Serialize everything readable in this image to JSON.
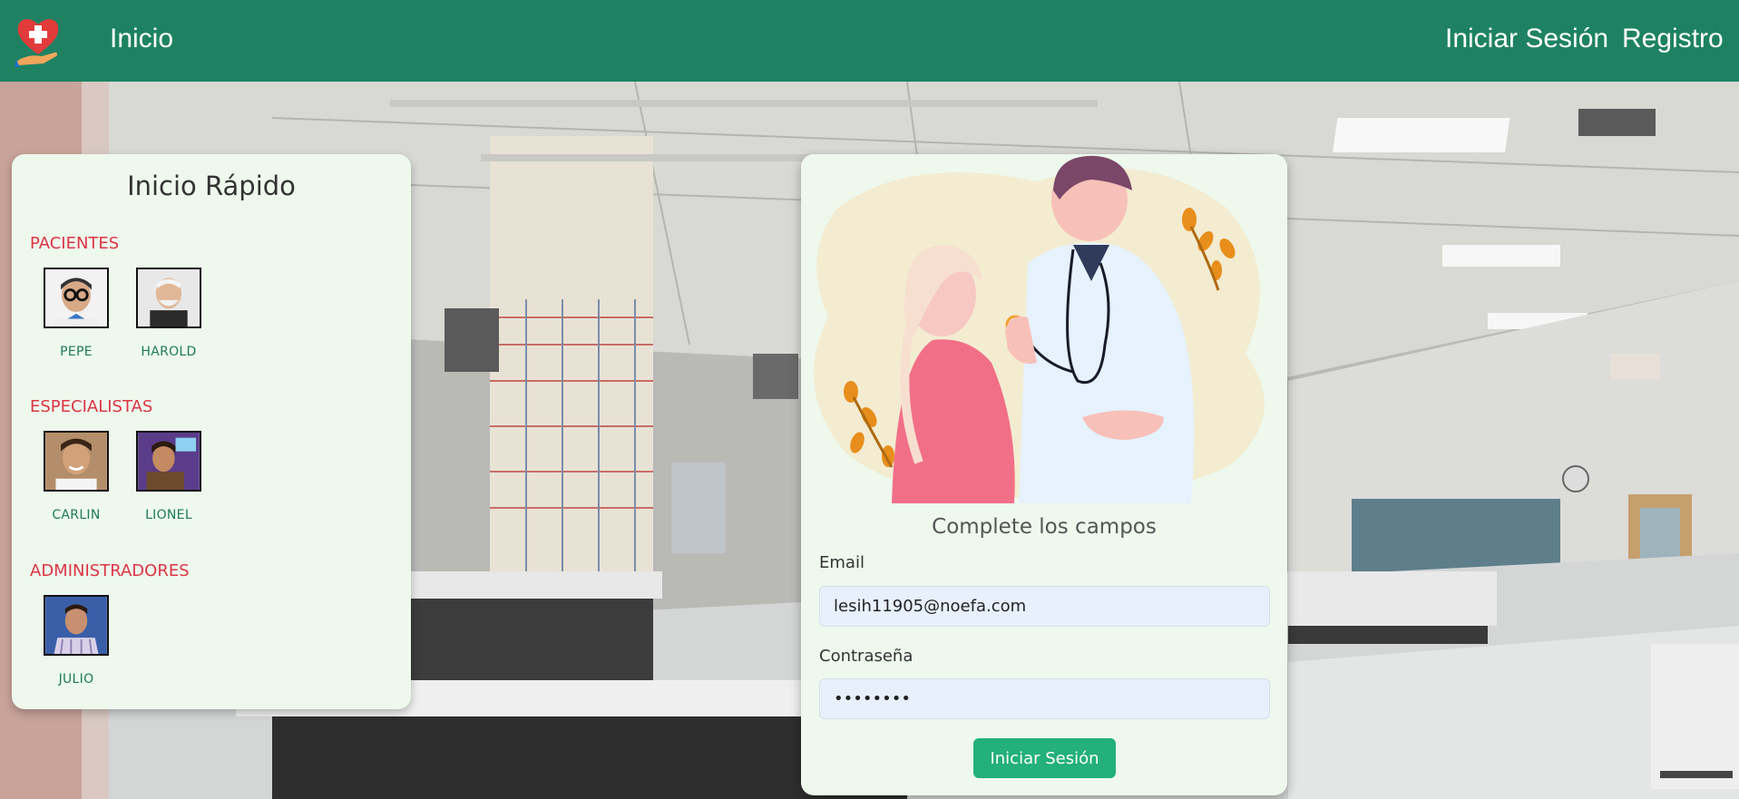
{
  "navbar": {
    "logo_icon": "heart-cross-hand-icon",
    "home": "Inicio",
    "login": "Iniciar Sesión",
    "register": "Registro",
    "color": "#1e8262"
  },
  "quick_start": {
    "title": "Inicio Rápido",
    "sections": {
      "patients": {
        "title": "PACIENTES",
        "users": [
          "PEPE",
          "HAROLD"
        ]
      },
      "specialists": {
        "title": "ESPECIALISTAS",
        "users": [
          "CARLIN",
          "LIONEL"
        ]
      },
      "admins": {
        "title": "ADMINISTRADORES",
        "users": [
          "JULIO"
        ]
      }
    },
    "section_color": "#dc3545",
    "name_color": "#1e7a5a"
  },
  "login": {
    "illustration": "doctor-patient-illustration",
    "heading": "Complete los campos",
    "email_label": "Email",
    "email_value": "lesih11905@noefa.com",
    "password_label": "Contraseña",
    "password_value": "********",
    "submit": "Iniciar Sesión",
    "button_color": "#23b07a"
  }
}
